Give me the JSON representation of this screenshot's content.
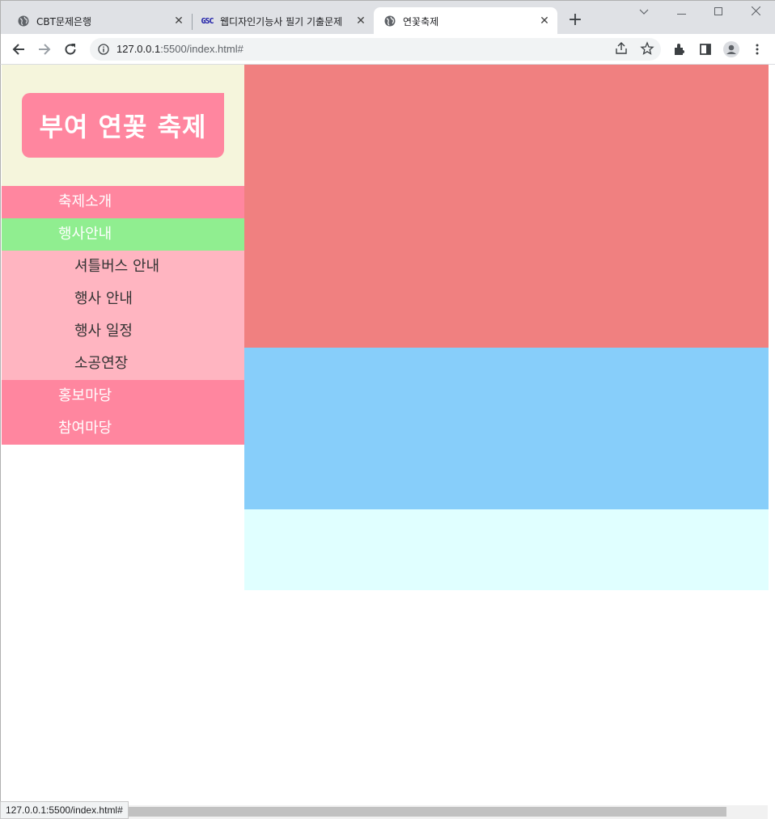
{
  "browser": {
    "tabs": [
      {
        "title": "CBT문제은행",
        "favicon": "globe-icon"
      },
      {
        "title": "웹디자인기능사 필기 기출문제",
        "favicon": "gsc-logo",
        "favicon_text": "GSC"
      },
      {
        "title": "연꽃축제",
        "favicon": "globe-icon"
      }
    ],
    "url_host": "127.0.0.1",
    "url_rest": ":5500/index.html#",
    "status_url": "127.0.0.1:5500/index.html#"
  },
  "page": {
    "logo_text": "부여 연꽃 축제",
    "menu": [
      {
        "label": "축제소개"
      },
      {
        "label": "행사안내",
        "submenu": [
          "셔틀버스 안내",
          "행사 안내",
          "행사 일정",
          "소공연장"
        ]
      },
      {
        "label": "홍보마당"
      },
      {
        "label": "참여마당"
      }
    ],
    "colors": {
      "logo_bg": "#ff869f",
      "header_bg": "#f5f5dc",
      "menu_bg": "#ff869f",
      "menu_active_bg": "#90ee90",
      "submenu_bg": "#ffb5c1",
      "banner_bg": "#f08080",
      "contents_bg": "#87cefa",
      "footer_bg": "#e0ffff"
    }
  }
}
